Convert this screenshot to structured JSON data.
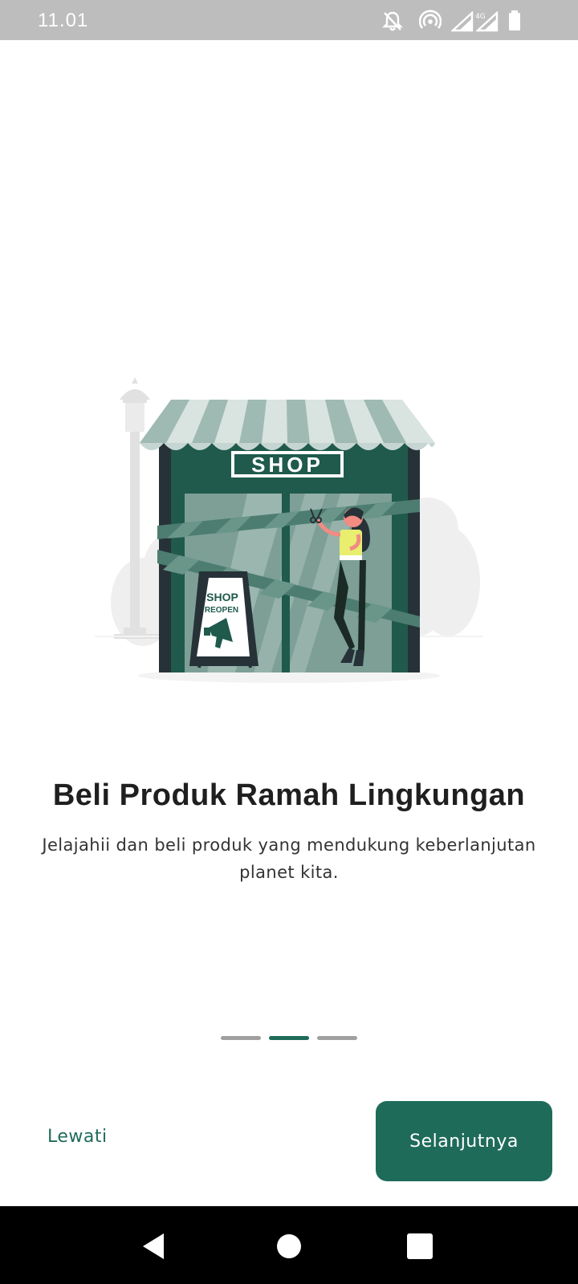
{
  "status_bar": {
    "time": "11.01",
    "icons": [
      "mute-bell-icon",
      "hotspot-icon",
      "signal-icon",
      "signal-4g-icon",
      "battery-icon"
    ],
    "network_label": "4G"
  },
  "illustration": {
    "shop_sign": "SHOP",
    "board_line1": "SHOP",
    "board_line2": "REOPEN"
  },
  "onboarding": {
    "title": "Beli Produk Ramah Lingkungan",
    "subtitle": "Jelajahii dan beli produk yang mendukung keberlanjutan planet kita.",
    "page_count": 3,
    "active_page": 2
  },
  "actions": {
    "skip_label": "Lewati",
    "next_label": "Selanjutnya"
  },
  "colors": {
    "accent": "#1f6b5a",
    "status_bar": "#bdbdbd",
    "indicator_inactive": "#a0a0a0"
  },
  "nav_bar": {
    "icons": [
      "back-icon",
      "home-icon",
      "recents-icon"
    ]
  }
}
